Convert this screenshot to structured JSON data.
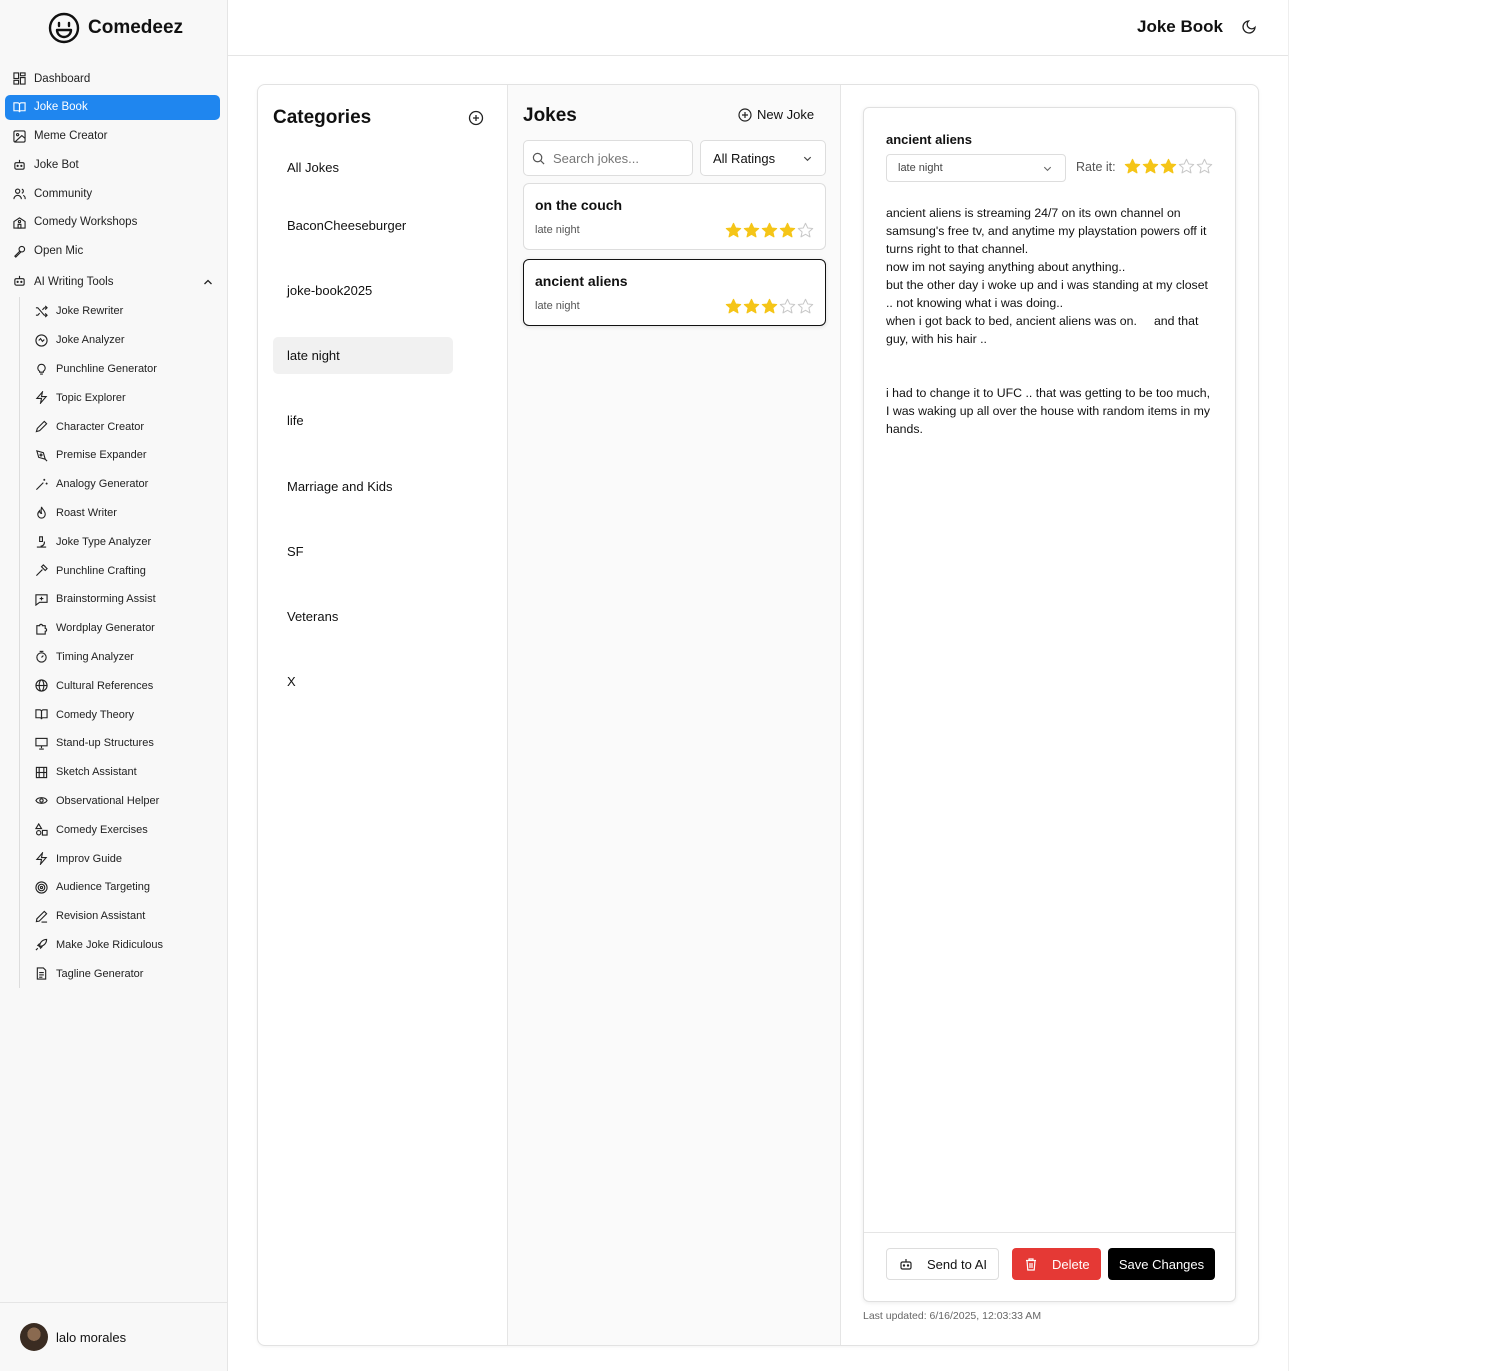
{
  "app": {
    "name": "Comedeez"
  },
  "header": {
    "title": "Joke Book"
  },
  "nav": [
    {
      "label": "Dashboard",
      "icon": "dashboard-icon"
    },
    {
      "label": "Joke Book",
      "icon": "book-open-icon",
      "active": true
    },
    {
      "label": "Meme Creator",
      "icon": "image-icon"
    },
    {
      "label": "Joke Bot",
      "icon": "bot-icon"
    },
    {
      "label": "Community",
      "icon": "users-icon"
    },
    {
      "label": "Comedy Workshops",
      "icon": "school-icon"
    },
    {
      "label": "Open Mic",
      "icon": "microphone-icon"
    }
  ],
  "ai_tools": {
    "label": "AI Writing Tools",
    "items": [
      {
        "label": "Joke Rewriter",
        "icon": "shuffle-icon"
      },
      {
        "label": "Joke Analyzer",
        "icon": "analyzer-icon"
      },
      {
        "label": "Punchline Generator",
        "icon": "lightbulb-icon"
      },
      {
        "label": "Topic Explorer",
        "icon": "zap-icon"
      },
      {
        "label": "Character Creator",
        "icon": "pen-icon"
      },
      {
        "label": "Premise Expander",
        "icon": "pen-tool-icon"
      },
      {
        "label": "Analogy Generator",
        "icon": "magic-wand-icon"
      },
      {
        "label": "Roast Writer",
        "icon": "flame-icon"
      },
      {
        "label": "Joke Type Analyzer",
        "icon": "microscope-icon"
      },
      {
        "label": "Punchline Crafting",
        "icon": "hammer-icon"
      },
      {
        "label": "Brainstorming Assist",
        "icon": "message-plus-icon"
      },
      {
        "label": "Wordplay Generator",
        "icon": "puzzle-icon"
      },
      {
        "label": "Timing Analyzer",
        "icon": "timer-icon"
      },
      {
        "label": "Cultural References",
        "icon": "globe-icon"
      },
      {
        "label": "Comedy Theory",
        "icon": "book-icon"
      },
      {
        "label": "Stand-up Structures",
        "icon": "presentation-icon"
      },
      {
        "label": "Sketch Assistant",
        "icon": "film-icon"
      },
      {
        "label": "Observational Helper",
        "icon": "eye-icon"
      },
      {
        "label": "Comedy Exercises",
        "icon": "shapes-icon"
      },
      {
        "label": "Improv Guide",
        "icon": "zap-icon"
      },
      {
        "label": "Audience Targeting",
        "icon": "target-icon"
      },
      {
        "label": "Revision Assistant",
        "icon": "pencil-icon"
      },
      {
        "label": "Make Joke Ridiculous",
        "icon": "rocket-icon"
      },
      {
        "label": "Tagline Generator",
        "icon": "file-text-icon"
      }
    ]
  },
  "user": {
    "name": "lalo morales"
  },
  "categories": {
    "title": "Categories",
    "items": [
      "All Jokes",
      "BaconCheeseburger",
      "joke-book2025",
      "late night",
      "life",
      "Marriage and Kids",
      "SF",
      "Veterans",
      "X"
    ],
    "active": "late night"
  },
  "jokes_panel": {
    "title": "Jokes",
    "new_label": "New Joke",
    "search_placeholder": "Search jokes...",
    "rating_filter": "All Ratings",
    "jokes": [
      {
        "title": "on the couch",
        "category": "late night",
        "rating": 4
      },
      {
        "title": "ancient aliens",
        "category": "late night",
        "rating": 3,
        "selected": true
      }
    ]
  },
  "detail": {
    "title": "ancient aliens",
    "category": "late night",
    "rate_label": "Rate it:",
    "rating": 3,
    "body": "ancient aliens is streaming 24/7 on its own channel on samsung's free tv, and anytime my playstation powers off it turns right to that channel.\nnow im not saying anything about anything..\nbut the other day i woke up and i was standing at my closet .. not knowing what i was doing..\nwhen i got back to bed, ancient aliens was on.     and that guy, with his hair ..\n\n\ni had to change it to UFC .. that was getting to be too much, I was waking up all over the house with random items in my hands.",
    "send_ai_label": "Send to AI",
    "delete_label": "Delete",
    "save_label": "Save Changes",
    "last_updated": "Last updated: 6/16/2025, 12:03:33 AM"
  },
  "colors": {
    "accent": "#1f86ef",
    "star": "#f5c518",
    "danger": "#e53935"
  }
}
